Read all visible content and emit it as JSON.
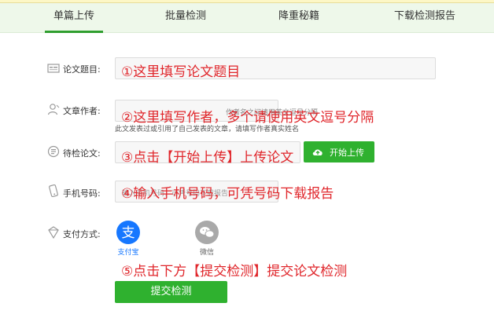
{
  "tabs": [
    {
      "label": "单篇上传"
    },
    {
      "label": "批量检测"
    },
    {
      "label": "降重秘籍"
    },
    {
      "label": "下载检测报告"
    }
  ],
  "form": {
    "title_label": "论文题目:",
    "author_label": "文章作者:",
    "author_placeholder": "作者名之间请用英文逗号分隔",
    "author_hint": "此文发表过或引用了自己发表的文章，请填写作者真实姓名",
    "paper_label": "待检论文:",
    "upload_button": "开始上传",
    "phone_label": "手机号码:",
    "phone_placeholder": "输入手机号码，可凭号码下载报告",
    "payment_label": "支付方式:",
    "payment_options": [
      {
        "name": "支付宝",
        "icon": "alipay-icon",
        "color": "#1677ff"
      },
      {
        "name": "微信",
        "icon": "wechat-icon",
        "color": "#a9a9a9"
      }
    ],
    "submit_button": "提交检测"
  },
  "annotations": {
    "step1": "①这里填写论文题目",
    "step2": "②这里填写作者，多个请使用英文逗号分隔",
    "step3": "③点击【开始上传】上传论文",
    "step4": "④输入手机号码，可凭号码下载报告",
    "step5": "⑤点击下方【提交检测】提交论文检测"
  },
  "colors": {
    "accent_green": "#2fb12f",
    "annotation_red": "#e0262b",
    "tab_bar_bg": "#eef8ea"
  }
}
